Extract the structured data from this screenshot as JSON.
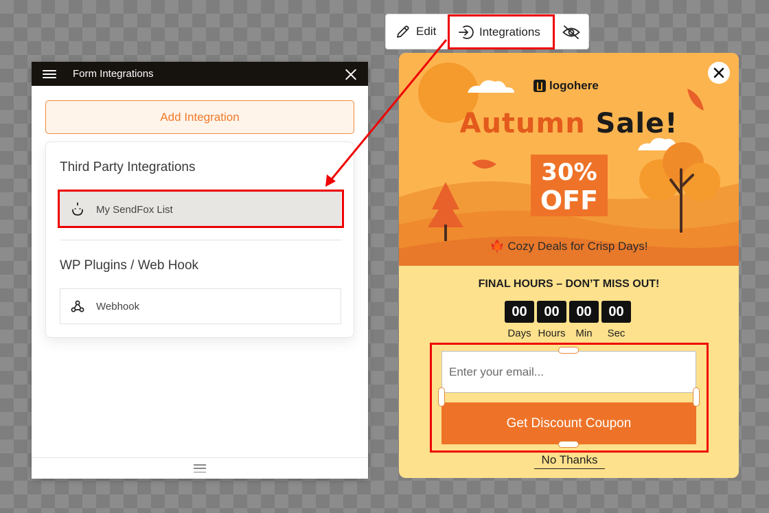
{
  "panel": {
    "title": "Form Integrations",
    "add_button": "Add Integration",
    "sections": [
      {
        "title": "Third Party Integrations",
        "items": [
          {
            "label": "My SendFox List",
            "icon": "sendfox-icon"
          }
        ]
      },
      {
        "title": "WP Plugins / Web Hook",
        "items": [
          {
            "label": "Webhook",
            "icon": "webhook-icon"
          }
        ]
      }
    ]
  },
  "toolbar": {
    "edit_label": "Edit",
    "integrations_label": "Integrations"
  },
  "popup": {
    "logo_text": "logohere",
    "headline_word1": "Autumn",
    "headline_word2": "Sale!",
    "discount_line1": "30%",
    "discount_line2": "OFF",
    "tagline": "🍁 Cozy Deals for Crisp Days!",
    "final_hours": "FINAL HOURS – DON’T MISS OUT!",
    "countdown": [
      {
        "value": "00",
        "label": "Days"
      },
      {
        "value": "00",
        "label": "Hours"
      },
      {
        "value": "00",
        "label": "Min"
      },
      {
        "value": "00",
        "label": "Sec"
      }
    ],
    "email_placeholder": "Enter your email...",
    "submit_label": "Get Discount Coupon",
    "no_thanks": "No Thanks"
  },
  "colors": {
    "accent": "#ee7328",
    "highlight": "#ee0000",
    "popup_bg": "#fde18c",
    "header_dark": "#16120e"
  }
}
